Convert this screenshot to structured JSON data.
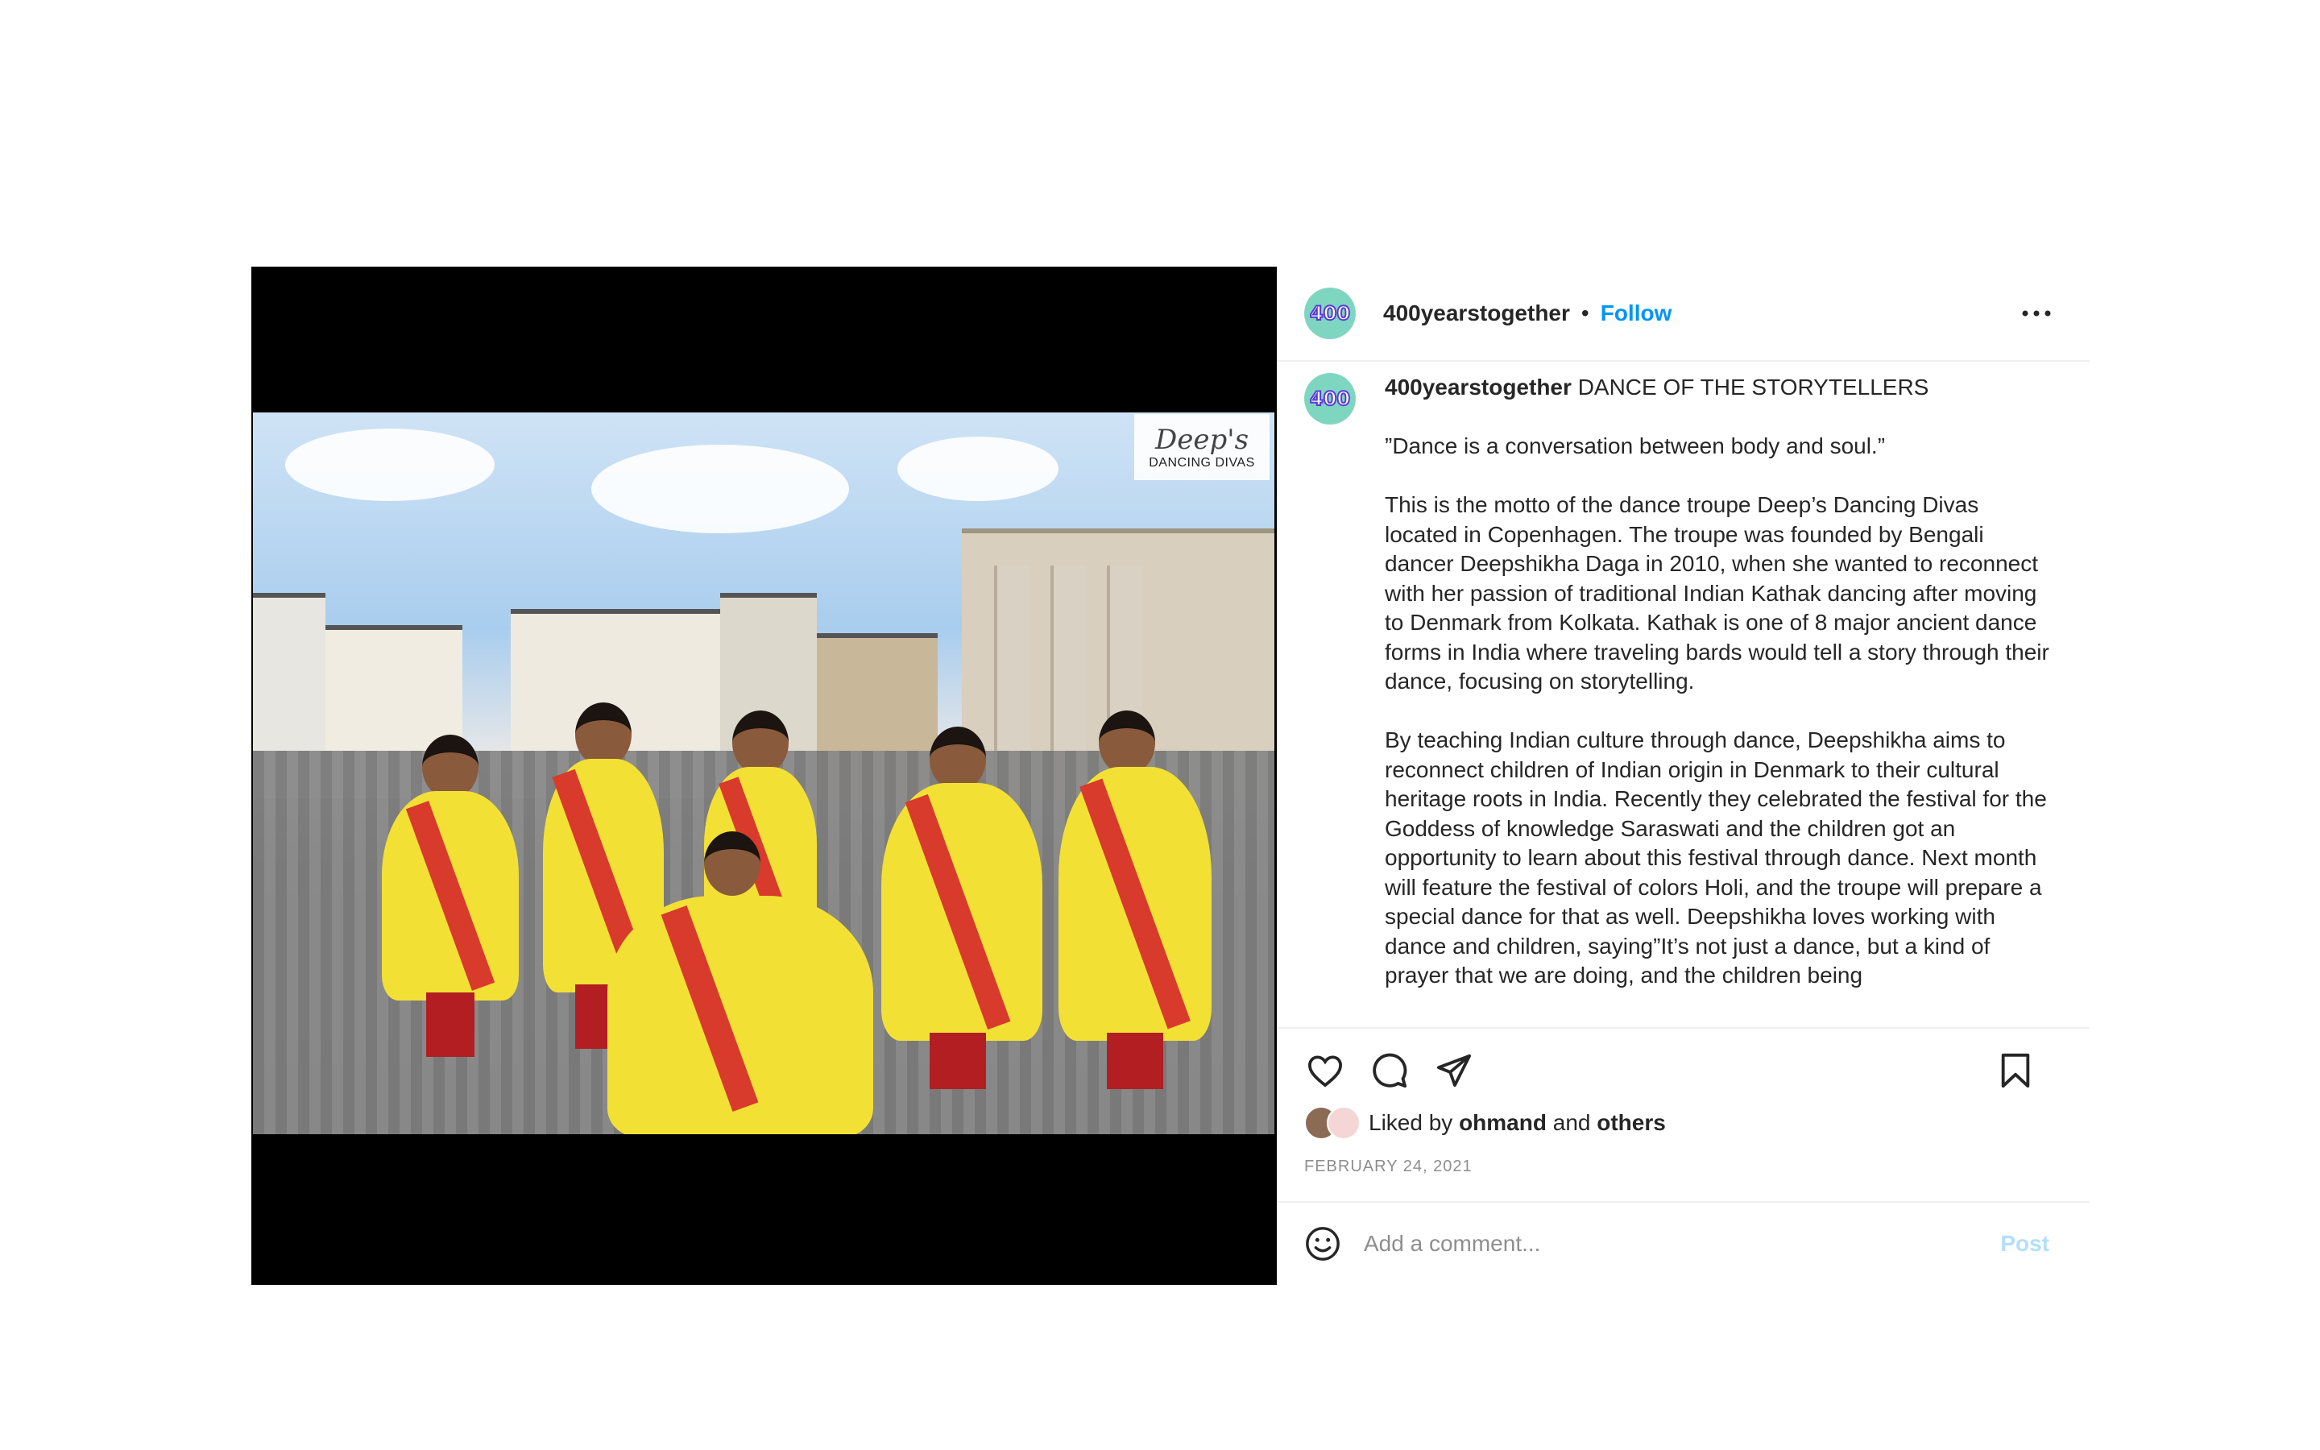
{
  "post": {
    "username": "400yearstogether",
    "avatar_text": "400",
    "separator": "•",
    "follow_label": "Follow",
    "more_icon": "more-horizontal-icon",
    "image_logo": {
      "script": "Deep's",
      "caps": "DANCING DIVAS"
    },
    "caption": {
      "username": "400yearstogether",
      "title": "DANCE OF THE STORYTELLERS",
      "quote": "”Dance is a conversation between body and soul.”",
      "para1": "This is the motto of the dance troupe Deep’s Dancing Divas located in Copenhagen. The troupe was founded by Bengali dancer Deepshikha Daga in 2010, when she wanted to reconnect with her passion of traditional Indian Kathak dancing after moving to Denmark from Kolkata. Kathak is one of 8 major ancient dance forms in India where traveling bards would tell a story through their dance, focusing on storytelling.",
      "para2": "By teaching Indian culture through dance, Deepshikha aims to reconnect children of Indian origin in Denmark to their cultural heritage roots in India. Recently they celebrated the festival for the Goddess of knowledge Saraswati and the children got an opportunity to learn about this festival through dance. Next month will feature the festival of colors Holi, and the troupe will prepare a special dance for that as well. Deepshikha loves working with dance and children, saying”It’s not just a dance, but a kind of prayer that we are doing, and the children being"
    },
    "likes": {
      "prefix": "Liked by",
      "user": "ohmand",
      "and": "and",
      "others": "others"
    },
    "date": "FEBRUARY 24, 2021",
    "comment": {
      "placeholder": "Add a comment...",
      "post_label": "Post"
    }
  },
  "colors": {
    "link": "#0095f6",
    "post_disabled": "#b2dffc",
    "avatar_bg": "#7fd6c0"
  }
}
